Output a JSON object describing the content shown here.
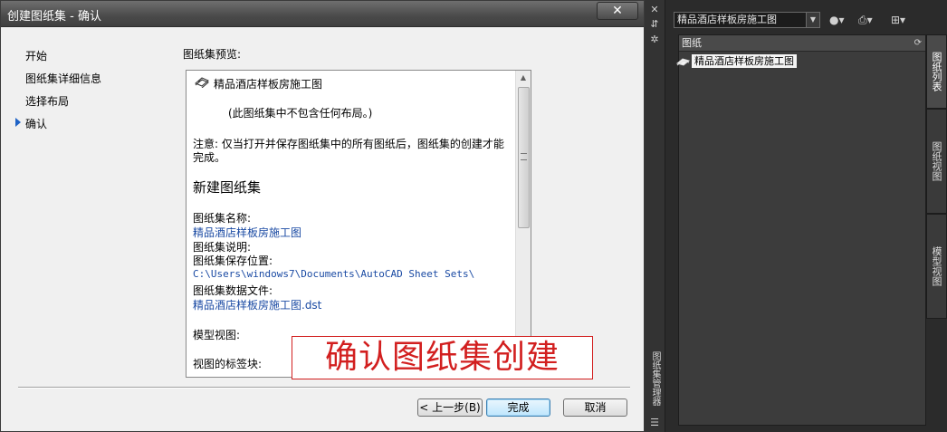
{
  "dialog": {
    "title": "创建图纸集 - 确认",
    "close_glyph": "✕",
    "nav": [
      "开始",
      "图纸集详细信息",
      "选择布局",
      "确认"
    ],
    "preview_label": "图纸集预览:",
    "preview": {
      "sheet_set_name": "精品酒店样板房施工图",
      "no_layouts_note": "(此图纸集中不包含任何布局。)",
      "note_line1": "注意: 仅当打开并保存图纸集中的所有图纸后，图纸集的创建才能",
      "note_line2": "完成。",
      "section_heading": "新建图纸集",
      "name_label": "图纸集名称:",
      "name_value": "精品酒店样板房施工图",
      "desc_label": "图纸集说明:",
      "location_label": "图纸集保存位置:",
      "location_value": "C:\\Users\\windows7\\Documents\\AutoCAD Sheet Sets\\",
      "data_file_label": "图纸集数据文件:",
      "data_file_value": "精品酒店样板房施工图.dst",
      "model_view_label": "模型视图:",
      "title_block_label": "视图的标签块:"
    },
    "annotation": "确认图纸集创建",
    "buttons": {
      "back": "< 上一步(B)",
      "finish": "完成",
      "cancel": "取消"
    }
  },
  "palette": {
    "sheet_set_select": "精品酒店样板房施工图",
    "panel_header": "图纸",
    "tree_item": "精品酒店样板房施工图",
    "side_tabs": [
      "图纸列表",
      "图纸视图",
      "模型视图"
    ],
    "strip_label": "图纸集管理器"
  }
}
